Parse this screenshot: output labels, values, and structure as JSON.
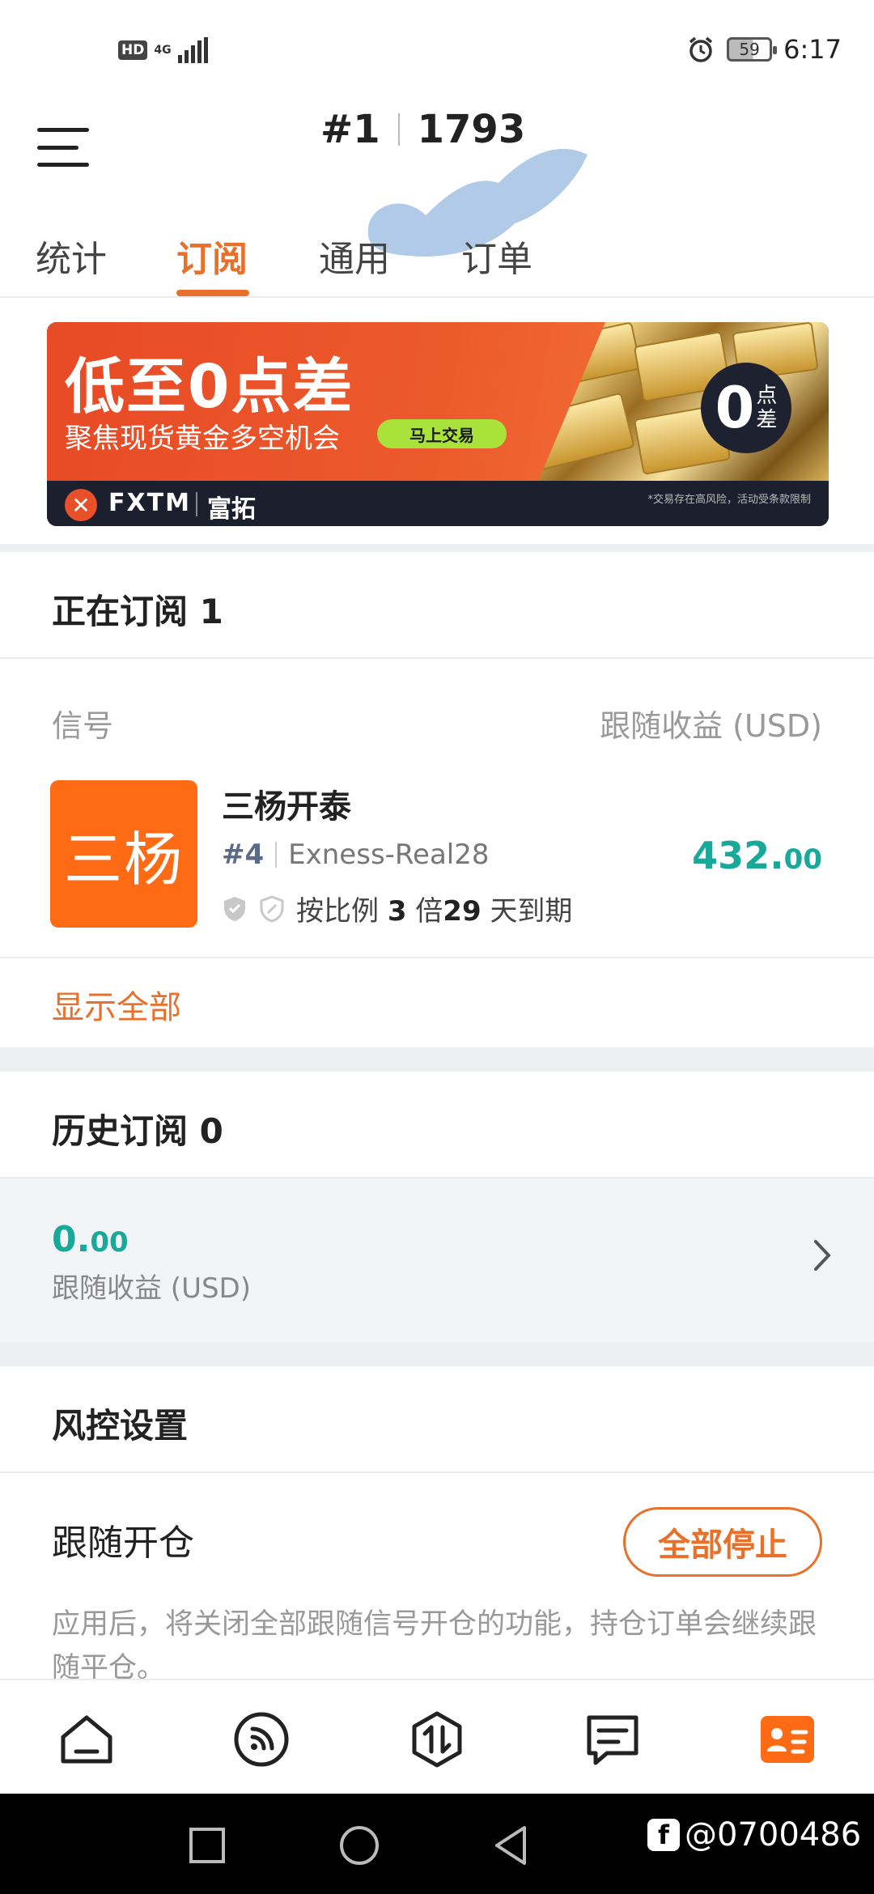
{
  "status_bar": {
    "hd": "HD",
    "network": "4G",
    "battery": "59",
    "time": "6:17"
  },
  "header": {
    "account_prefix": "#1",
    "account_number": "1793"
  },
  "tabs": [
    {
      "label": "统计",
      "active": false
    },
    {
      "label": "订阅",
      "active": true
    },
    {
      "label": "通用",
      "active": false
    },
    {
      "label": "订单",
      "active": false
    }
  ],
  "banner": {
    "headline": "低至0点差",
    "subline": "聚焦现货黄金多空机会",
    "cta": "马上交易",
    "badge_number": "0",
    "badge_text_1": "点",
    "badge_text_2": "差",
    "brand": "FXTM",
    "brand_cn": "富拓",
    "disclaimer": "*交易存在高风险，活动受条款限制"
  },
  "current_subscriptions": {
    "title": "正在订阅 1",
    "col_signal": "信号",
    "col_profit": "跟随收益 (USD)",
    "signal": {
      "avatar_text": "三杨",
      "name": "三杨开泰",
      "rank": "#4",
      "server": "Exness-Real28",
      "mode_prefix": "按比例",
      "multiplier": "3",
      "multiplier_unit": "倍",
      "days": "29",
      "days_suffix": "天到期",
      "profit_int": "432.",
      "profit_dec": "00"
    },
    "show_all": "显示全部"
  },
  "history_subscriptions": {
    "title": "历史订阅 0",
    "value_int": "0.",
    "value_dec": "00",
    "label": "跟随收益 (USD)"
  },
  "risk_settings": {
    "title": "风控设置",
    "follow_title": "跟随开仓",
    "stop_button": "全部停止",
    "description": "应用后，将关闭全部跟随信号开仓的功能，持仓订单会继续跟随平仓。"
  },
  "bottom_nav": [
    {
      "icon": "home-icon",
      "active": false
    },
    {
      "icon": "signal-feed-icon",
      "active": false
    },
    {
      "icon": "trade-icon",
      "active": false
    },
    {
      "icon": "message-icon",
      "active": false
    },
    {
      "icon": "account-card-icon",
      "active": true
    }
  ],
  "watermark": {
    "fb": "f",
    "handle": "@0700486"
  },
  "colors": {
    "accent": "#e8702a",
    "profit": "#1aa89a",
    "avatar_bg": "#ff6a14"
  }
}
